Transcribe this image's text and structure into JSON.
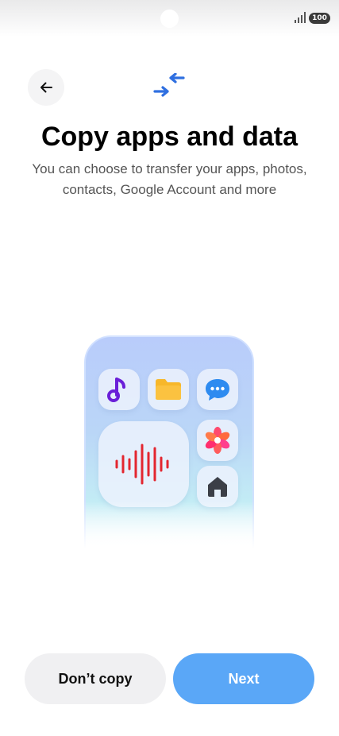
{
  "status_bar": {
    "battery_level": "100",
    "icons": [
      "signal-icon",
      "battery-icon"
    ]
  },
  "header": {
    "back_icon": "arrow-left-icon",
    "transfer_icon": "transfer-arrows-icon",
    "title": "Copy apps and data",
    "subtitle": "You can choose to transfer your apps, photos, contacts, Google Account and more"
  },
  "illustration": {
    "apps": [
      "music-icon",
      "folder-icon",
      "messages-icon",
      "sound-recorder-icon",
      "gallery-icon",
      "home-icon"
    ]
  },
  "actions": {
    "dont_copy_label": "Don’t copy",
    "next_label": "Next"
  },
  "colors": {
    "accent": "#5aa7f7",
    "transfer_icon": "#2f6fe0"
  }
}
